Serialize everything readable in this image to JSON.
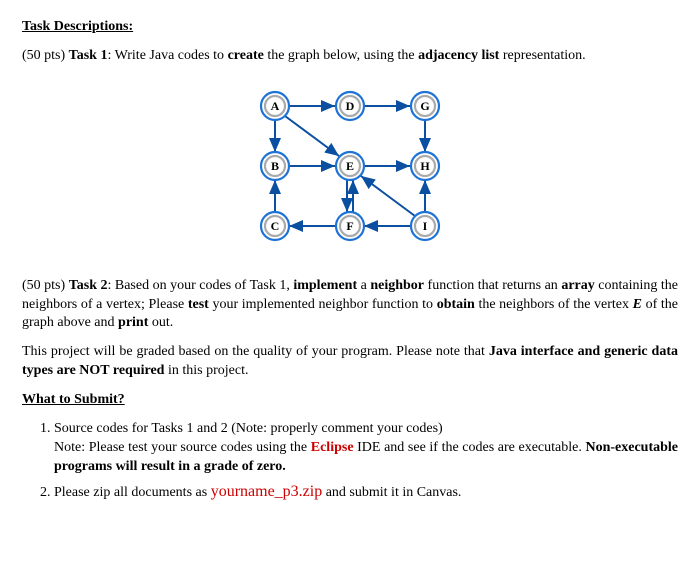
{
  "heading": "Task Descriptions:",
  "task1": {
    "pts": "(50 pts) ",
    "label": "Task 1",
    "sep": ": Write Java codes to ",
    "create": "create",
    "rest": " the graph below, using the ",
    "adj": "adjacency list",
    "rep": " representation."
  },
  "graph": {
    "nodes": {
      "A": "A",
      "B": "B",
      "C": "C",
      "D": "D",
      "E": "E",
      "F": "F",
      "G": "G",
      "H": "H",
      "I": "I"
    }
  },
  "task2": {
    "pts": "(50 pts) ",
    "label": "Task 2",
    "t1": ": Based on your codes of Task 1, ",
    "impl": "implement",
    "t2": " a ",
    "neigh": "neighbor",
    "t3": " function that returns an ",
    "arr": "array",
    "t4": " containing the neighbors of a vertex; Please ",
    "test": "test",
    "t5": " your implemented neighbor function to ",
    "obt": "obtain",
    "t6": " the neighbors of the vertex ",
    "E": "E",
    "t7": " of the graph above and ",
    "print": "print",
    "t8": " out."
  },
  "grading": {
    "t1": "This project will be graded based on the quality of your program. Please note that ",
    "bold": "Java interface and generic data types are NOT required",
    "t2": " in this project."
  },
  "whatHeading": "What to Submit?",
  "submit": {
    "item1a": "Source codes for Tasks 1 and 2 (Note: properly comment your codes)",
    "item1b_pre": "Note: Please test your source codes using the ",
    "item1b_eclipse": "Eclipse",
    "item1b_mid": " IDE and see if the codes are executable. ",
    "item1b_bold": "Non-executable programs will result in a grade of zero.",
    "item2_pre": "Please zip all documents as ",
    "item2_zip": "yourname_p3.zip",
    "item2_post": " and submit it in Canvas."
  }
}
